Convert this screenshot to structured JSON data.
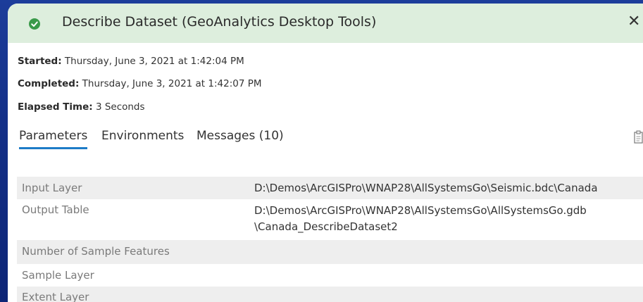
{
  "dialog": {
    "title": "Describe Dataset (GeoAnalytics Desktop Tools)",
    "status_icon": "check-circle-icon",
    "close_glyph": "✕"
  },
  "info": {
    "started_label": "Started:",
    "started_value": "Thursday, June 3, 2021 at 1:42:04 PM",
    "completed_label": "Completed:",
    "completed_value": "Thursday, June 3, 2021 at 1:42:07 PM",
    "elapsed_label": "Elapsed Time:",
    "elapsed_value": "3 Seconds"
  },
  "tabs": [
    {
      "label": "Parameters",
      "active": true
    },
    {
      "label": "Environments",
      "active": false
    },
    {
      "label": "Messages (10)",
      "active": false
    }
  ],
  "params": [
    {
      "name": "Input Layer",
      "value": "D:\\Demos\\ArcGISPro\\WNAP28\\AllSystemsGo\\Seismic.bdc\\Canada",
      "value2": ""
    },
    {
      "name": "Output Table",
      "value": "D:\\Demos\\ArcGISPro\\WNAP28\\AllSystemsGo\\AllSystemsGo.gdb",
      "value2": "\\Canada_DescribeDataset2"
    },
    {
      "name": "Number of Sample Features",
      "value": "",
      "value2": ""
    },
    {
      "name": "Sample Layer",
      "value": "",
      "value2": ""
    },
    {
      "name": "Extent Layer",
      "value": "",
      "value2": ""
    }
  ],
  "colors": {
    "header_bg": "#ddeedd",
    "success_green": "#3a9a4a",
    "tab_underline": "#1d7cc7",
    "background": "#143088"
  }
}
